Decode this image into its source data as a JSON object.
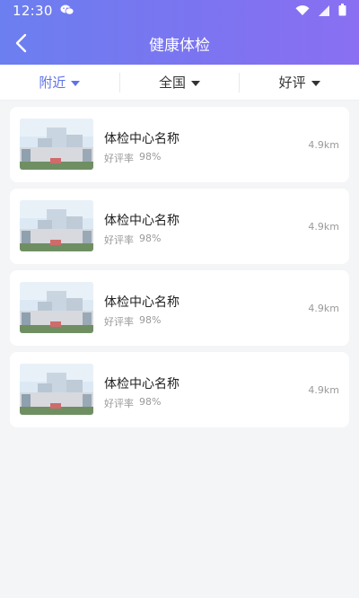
{
  "status_bar": {
    "time": "12:30"
  },
  "header": {
    "title": "健康体检"
  },
  "filters": [
    {
      "label": "附近",
      "active": true
    },
    {
      "label": "全国",
      "active": false
    },
    {
      "label": "好评",
      "active": false
    }
  ],
  "list": [
    {
      "name": "体检中心名称",
      "rating_label": "好评率",
      "rating_value": "98%",
      "distance": "4.9km"
    },
    {
      "name": "体检中心名称",
      "rating_label": "好评率",
      "rating_value": "98%",
      "distance": "4.9km"
    },
    {
      "name": "体检中心名称",
      "rating_label": "好评率",
      "rating_value": "98%",
      "distance": "4.9km"
    },
    {
      "name": "体检中心名称",
      "rating_label": "好评率",
      "rating_value": "98%",
      "distance": "4.9km"
    }
  ],
  "icons": {
    "back": "back-arrow-icon",
    "wechat": "wechat-icon",
    "wifi": "wifi-icon",
    "signal": "signal-icon",
    "battery": "battery-icon",
    "caret": "caret-down-icon"
  },
  "colors": {
    "header_gradient_start": "#6b7ff0",
    "header_gradient_end": "#8a6ff2",
    "active_filter": "#5f73e6",
    "background": "#f4f5f7"
  }
}
